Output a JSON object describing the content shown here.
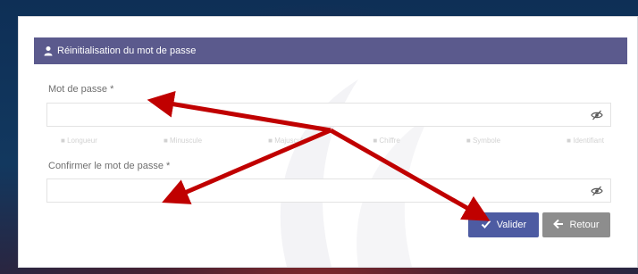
{
  "panel": {
    "title_prefix": "Réinitialisation du ",
    "title_bold": "mot de passe"
  },
  "form": {
    "password_label": "Mot de passe *",
    "confirm_label": "Confirmer le mot de passe *",
    "password_value": "",
    "confirm_value": ""
  },
  "criteria": [
    "Longueur",
    "Minuscule",
    "Majuscule",
    "Chiffre",
    "Symbole",
    "Identifiant"
  ],
  "buttons": {
    "submit_label": "Valider",
    "back_label": "Retour"
  },
  "colors": {
    "heading": "#5b5a8d",
    "submit": "#4d5ba2",
    "back": "#8d8d8d",
    "arrow": "#c00000"
  }
}
